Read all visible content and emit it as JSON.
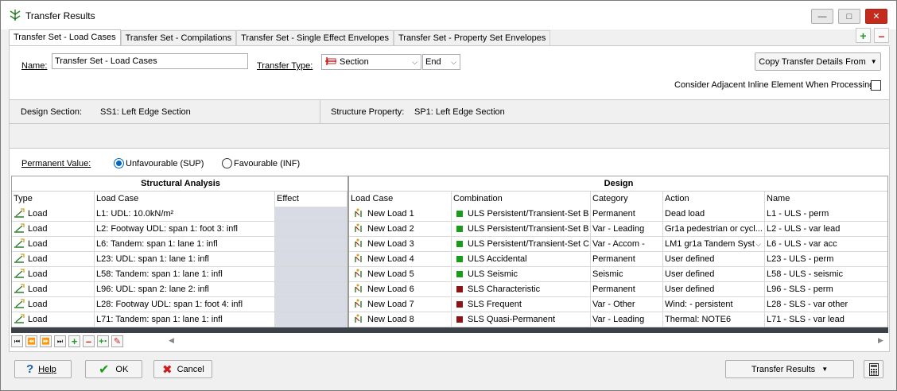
{
  "window": {
    "title": "Transfer Results"
  },
  "tabs": [
    "Transfer Set - Load Cases",
    "Transfer Set - Compilations",
    "Transfer Set - Single Effect Envelopes",
    "Transfer Set - Property Set Envelopes"
  ],
  "form": {
    "name_label": "Name:",
    "name_value": "Transfer Set - Load Cases",
    "transfer_type_label": "Transfer Type:",
    "transfer_type_value": "Section",
    "end_value": "End",
    "copy_button": "Copy Transfer Details From",
    "consider_label": "Consider Adjacent Inline Element When Processing"
  },
  "section": {
    "design_label": "Design Section:",
    "design_value": "SS1: Left Edge Section",
    "structure_label": "Structure Property:",
    "structure_value": "SP1: Left Edge Section"
  },
  "permanent": {
    "label": "Permanent Value:",
    "opt1": "Unfavourable (SUP)",
    "opt2": "Favourable (INF)"
  },
  "grid": {
    "group_left": "Structural Analysis",
    "group_right": "Design",
    "headers": [
      "Type",
      "Load Case",
      "Effect",
      "Load Case",
      "Combination",
      "Category",
      "Action",
      "Name"
    ],
    "rows": [
      {
        "type": "Load",
        "lc": "L1: UDL: 10.0kN/m²",
        "dlc": "New Load 1",
        "comb": "ULS Persistent/Transient-Set B",
        "cc": "#1a9c1a",
        "cat": "Permanent",
        "action": "Dead load",
        "name": "L1 - ULS - perm"
      },
      {
        "type": "Load",
        "lc": "L2: Footway UDL: span 1: foot 3: infl",
        "dlc": "New Load 2",
        "comb": "ULS Persistent/Transient-Set B",
        "cc": "#1a9c1a",
        "cat": "Var - Leading",
        "action": "Gr1a pedestrian or cycl...",
        "name": "L2 - ULS - var lead"
      },
      {
        "type": "Load",
        "lc": "L6: Tandem: span 1: lane 1: infl",
        "dlc": "New Load 3",
        "comb": "ULS Persistent/Transient-Set C",
        "cc": "#1a9c1a",
        "cat": "Var - Accom -",
        "action": "LM1 gr1a Tandem Syst",
        "name": "L6 - ULS - var acc"
      },
      {
        "type": "Load",
        "lc": "L23: UDL: span 1: lane 1: infl",
        "dlc": "New Load 4",
        "comb": "ULS Accidental",
        "cc": "#1a9c1a",
        "cat": "Permanent",
        "action": "User defined",
        "name": "L23 - ULS - perm"
      },
      {
        "type": "Load",
        "lc": "L58: Tandem: span 1: lane 1: infl",
        "dlc": "New Load 5",
        "comb": "ULS Seismic",
        "cc": "#1a9c1a",
        "cat": "Seismic",
        "action": "User defined",
        "name": "L58 - ULS - seismic"
      },
      {
        "type": "Load",
        "lc": "L96: UDL: span 2: lane 2: infl",
        "dlc": "New Load 6",
        "comb": "SLS Characteristic",
        "cc": "#8b1414",
        "cat": "Permanent",
        "action": "User defined",
        "name": "L96 - SLS - perm"
      },
      {
        "type": "Load",
        "lc": "L28: Footway UDL: span 1: foot 4: infl",
        "dlc": "New Load 7",
        "comb": "SLS Frequent",
        "cc": "#8b1414",
        "cat": "Var - Other",
        "action": "Wind: - persistent",
        "name": "L28 - SLS - var other"
      },
      {
        "type": "Load",
        "lc": "L71: Tandem: span 1: lane 1: infl",
        "dlc": "New Load 8",
        "comb": "SLS Quasi-Permanent",
        "cc": "#8b1414",
        "cat": "Var - Leading",
        "action": "Thermal: NOTE6",
        "name": "L71 - SLS - var lead"
      }
    ]
  },
  "footer": {
    "help": "Help",
    "ok": "OK",
    "cancel": "Cancel",
    "transfer_results": "Transfer Results"
  }
}
